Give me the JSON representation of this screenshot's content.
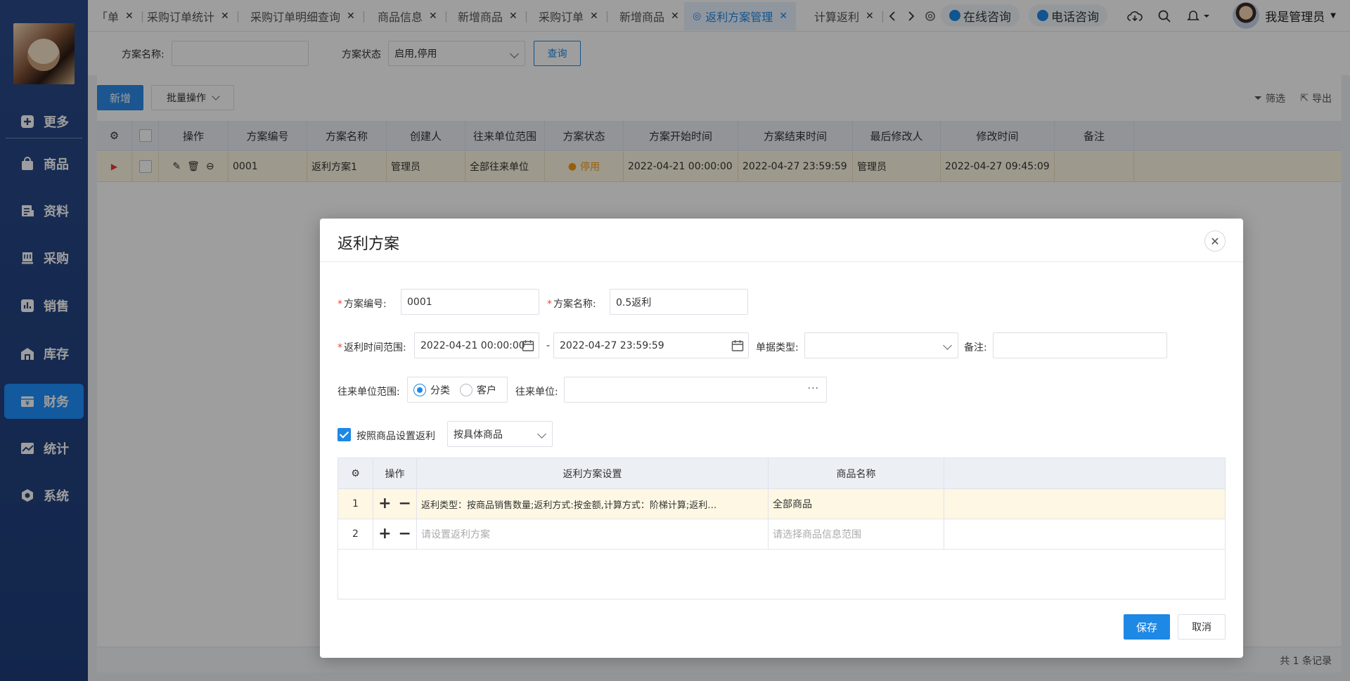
{
  "sidebar": {
    "items": [
      {
        "label": "更多",
        "icon": "plus-square-icon"
      },
      {
        "label": "商品",
        "icon": "bag-icon"
      },
      {
        "label": "资料",
        "icon": "document-icon"
      },
      {
        "label": "采购",
        "icon": "cart-icon"
      },
      {
        "label": "销售",
        "icon": "chart-icon"
      },
      {
        "label": "库存",
        "icon": "warehouse-icon"
      },
      {
        "label": "财务",
        "icon": "wallet-icon"
      },
      {
        "label": "统计",
        "icon": "trend-icon"
      },
      {
        "label": "系统",
        "icon": "hexagon-gear-icon"
      }
    ],
    "active": "财务"
  },
  "tabs": [
    {
      "label": "「单"
    },
    {
      "label": "采购订单统计"
    },
    {
      "label": "采购订单明细查询"
    },
    {
      "label": "商品信息"
    },
    {
      "label": "新增商品"
    },
    {
      "label": "采购订单"
    },
    {
      "label": "新增商品"
    },
    {
      "label": "返利方案管理"
    },
    {
      "label": "计算返利"
    }
  ],
  "topbar": {
    "online": "在线咨询",
    "phone": "电话咨询",
    "user": "我是管理员"
  },
  "filter": {
    "name_label": "方案名称:",
    "name_value": "",
    "status_label": "方案状态",
    "status_value": "启用,停用",
    "query": "查询"
  },
  "toolbar": {
    "add": "新增",
    "batch": "批量操作",
    "filter": "筛选",
    "export": "导出"
  },
  "grid": {
    "columns": [
      "操作",
      "方案编号",
      "方案名称",
      "创建人",
      "往来单位范围",
      "方案状态",
      "方案开始时间",
      "方案结束时间",
      "最后修改人",
      "修改时间",
      "备注"
    ],
    "rows": [
      {
        "code": "0001",
        "name": "返利方案1",
        "creator": "管理员",
        "scope": "全部往来单位",
        "status": "停用",
        "start": "2022-04-21 00:00:00",
        "end": "2022-04-27 23:59:59",
        "modifier": "管理员",
        "mtime": "2022-04-27 09:45:09",
        "remark": ""
      }
    ],
    "footer": "共 1 条记录"
  },
  "dialog": {
    "title": "返利方案",
    "code_label": "方案编号:",
    "code_value": "0001",
    "name_label": "方案名称:",
    "name_value": "0.5返利",
    "range_label": "返利时间范围:",
    "range_start": "2022-04-21 00:00:00",
    "range_sep": "-",
    "range_end": "2022-04-27 23:59:59",
    "billtype_label": "单据类型:",
    "billtype_value": "",
    "remark_label": "备注:",
    "remark_value": "",
    "scope_label": "往来单位范围:",
    "scope_opt1": "分类",
    "scope_opt2": "客户",
    "unit_label": "往来单位:",
    "unit_value": "",
    "by_goods_label": "按照商品设置返利",
    "by_goods_select": "按具体商品",
    "table": {
      "col_op": "操作",
      "col_setting": "返利方案设置",
      "col_goods": "商品名称",
      "rows": [
        {
          "no": "1",
          "setting": "返利类型：按商品销售数量;返利方式:按金额,计算方式：阶梯计算;返利…",
          "goods": "全部商品",
          "placeholder": false
        },
        {
          "no": "2",
          "setting": "请设置返利方案",
          "goods": "请选择商品信息范围",
          "placeholder": true
        }
      ]
    },
    "save": "保存",
    "cancel": "取消"
  }
}
